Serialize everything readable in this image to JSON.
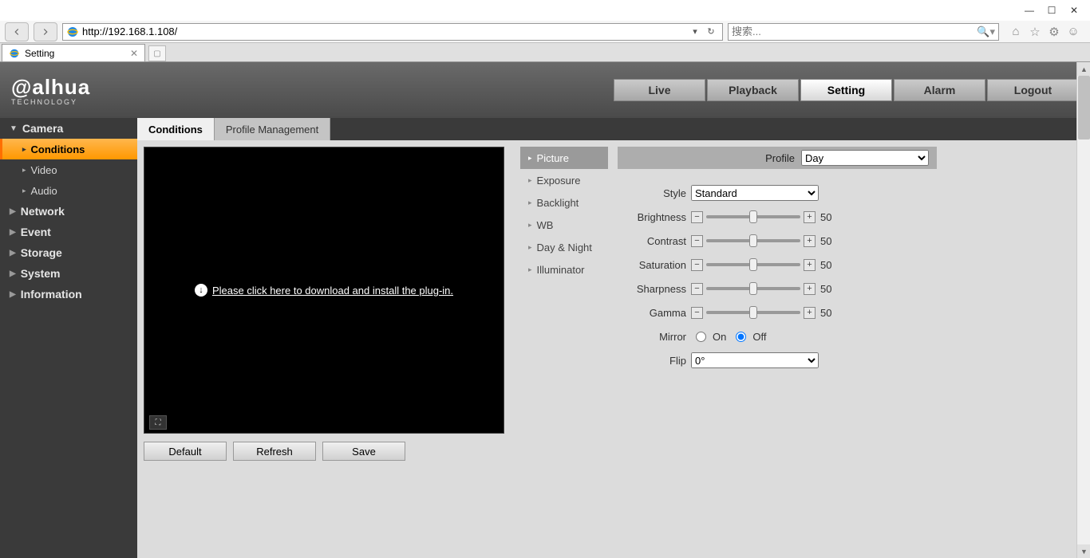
{
  "browser": {
    "url": "http://192.168.1.108/",
    "search_placeholder": "搜索...",
    "tab_title": "Setting"
  },
  "logo": {
    "main": "alhua",
    "sub": "TECHNOLOGY"
  },
  "topnav": [
    "Live",
    "Playback",
    "Setting",
    "Alarm",
    "Logout"
  ],
  "topnav_active": 2,
  "sidebar": [
    {
      "label": "Camera",
      "open": true,
      "subs": [
        {
          "label": "Conditions",
          "active": true
        },
        {
          "label": "Video"
        },
        {
          "label": "Audio"
        }
      ]
    },
    {
      "label": "Network"
    },
    {
      "label": "Event"
    },
    {
      "label": "Storage"
    },
    {
      "label": "System"
    },
    {
      "label": "Information"
    }
  ],
  "subtabs": [
    "Conditions",
    "Profile Management"
  ],
  "subtab_active": 0,
  "preview_msg": "Please click here to download and install the plug-in.",
  "actions": {
    "default": "Default",
    "refresh": "Refresh",
    "save": "Save"
  },
  "submenu": [
    "Picture",
    "Exposure",
    "Backlight",
    "WB",
    "Day & Night",
    "Illuminator"
  ],
  "submenu_active": 0,
  "profile_label": "Profile",
  "profile_value": "Day",
  "settings": {
    "style_label": "Style",
    "style_value": "Standard",
    "brightness_label": "Brightness",
    "brightness_value": "50",
    "contrast_label": "Contrast",
    "contrast_value": "50",
    "saturation_label": "Saturation",
    "saturation_value": "50",
    "sharpness_label": "Sharpness",
    "sharpness_value": "50",
    "gamma_label": "Gamma",
    "gamma_value": "50",
    "mirror_label": "Mirror",
    "mirror_on": "On",
    "mirror_off": "Off",
    "mirror_value": "Off",
    "flip_label": "Flip",
    "flip_value": "0°"
  }
}
